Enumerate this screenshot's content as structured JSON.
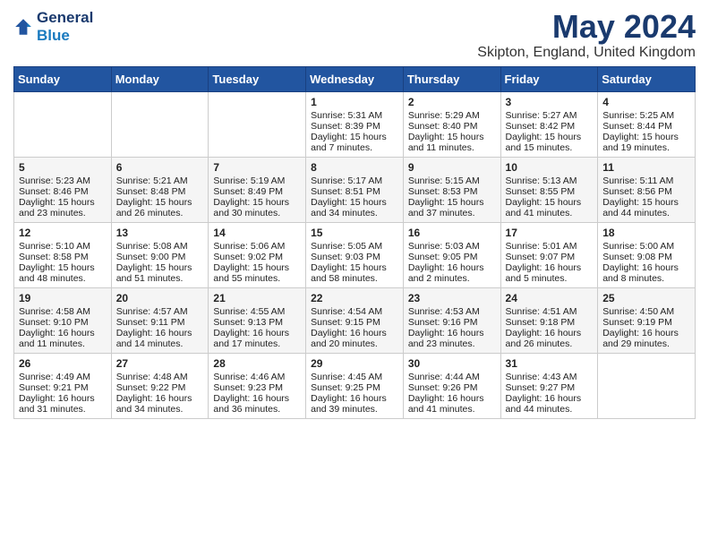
{
  "header": {
    "logo_line1": "General",
    "logo_line2": "Blue",
    "title": "May 2024",
    "subtitle": "Skipton, England, United Kingdom"
  },
  "weekdays": [
    "Sunday",
    "Monday",
    "Tuesday",
    "Wednesday",
    "Thursday",
    "Friday",
    "Saturday"
  ],
  "weeks": [
    [
      {
        "day": "",
        "lines": []
      },
      {
        "day": "",
        "lines": []
      },
      {
        "day": "",
        "lines": []
      },
      {
        "day": "1",
        "lines": [
          "Sunrise: 5:31 AM",
          "Sunset: 8:39 PM",
          "Daylight: 15 hours",
          "and 7 minutes."
        ]
      },
      {
        "day": "2",
        "lines": [
          "Sunrise: 5:29 AM",
          "Sunset: 8:40 PM",
          "Daylight: 15 hours",
          "and 11 minutes."
        ]
      },
      {
        "day": "3",
        "lines": [
          "Sunrise: 5:27 AM",
          "Sunset: 8:42 PM",
          "Daylight: 15 hours",
          "and 15 minutes."
        ]
      },
      {
        "day": "4",
        "lines": [
          "Sunrise: 5:25 AM",
          "Sunset: 8:44 PM",
          "Daylight: 15 hours",
          "and 19 minutes."
        ]
      }
    ],
    [
      {
        "day": "5",
        "lines": [
          "Sunrise: 5:23 AM",
          "Sunset: 8:46 PM",
          "Daylight: 15 hours",
          "and 23 minutes."
        ]
      },
      {
        "day": "6",
        "lines": [
          "Sunrise: 5:21 AM",
          "Sunset: 8:48 PM",
          "Daylight: 15 hours",
          "and 26 minutes."
        ]
      },
      {
        "day": "7",
        "lines": [
          "Sunrise: 5:19 AM",
          "Sunset: 8:49 PM",
          "Daylight: 15 hours",
          "and 30 minutes."
        ]
      },
      {
        "day": "8",
        "lines": [
          "Sunrise: 5:17 AM",
          "Sunset: 8:51 PM",
          "Daylight: 15 hours",
          "and 34 minutes."
        ]
      },
      {
        "day": "9",
        "lines": [
          "Sunrise: 5:15 AM",
          "Sunset: 8:53 PM",
          "Daylight: 15 hours",
          "and 37 minutes."
        ]
      },
      {
        "day": "10",
        "lines": [
          "Sunrise: 5:13 AM",
          "Sunset: 8:55 PM",
          "Daylight: 15 hours",
          "and 41 minutes."
        ]
      },
      {
        "day": "11",
        "lines": [
          "Sunrise: 5:11 AM",
          "Sunset: 8:56 PM",
          "Daylight: 15 hours",
          "and 44 minutes."
        ]
      }
    ],
    [
      {
        "day": "12",
        "lines": [
          "Sunrise: 5:10 AM",
          "Sunset: 8:58 PM",
          "Daylight: 15 hours",
          "and 48 minutes."
        ]
      },
      {
        "day": "13",
        "lines": [
          "Sunrise: 5:08 AM",
          "Sunset: 9:00 PM",
          "Daylight: 15 hours",
          "and 51 minutes."
        ]
      },
      {
        "day": "14",
        "lines": [
          "Sunrise: 5:06 AM",
          "Sunset: 9:02 PM",
          "Daylight: 15 hours",
          "and 55 minutes."
        ]
      },
      {
        "day": "15",
        "lines": [
          "Sunrise: 5:05 AM",
          "Sunset: 9:03 PM",
          "Daylight: 15 hours",
          "and 58 minutes."
        ]
      },
      {
        "day": "16",
        "lines": [
          "Sunrise: 5:03 AM",
          "Sunset: 9:05 PM",
          "Daylight: 16 hours",
          "and 2 minutes."
        ]
      },
      {
        "day": "17",
        "lines": [
          "Sunrise: 5:01 AM",
          "Sunset: 9:07 PM",
          "Daylight: 16 hours",
          "and 5 minutes."
        ]
      },
      {
        "day": "18",
        "lines": [
          "Sunrise: 5:00 AM",
          "Sunset: 9:08 PM",
          "Daylight: 16 hours",
          "and 8 minutes."
        ]
      }
    ],
    [
      {
        "day": "19",
        "lines": [
          "Sunrise: 4:58 AM",
          "Sunset: 9:10 PM",
          "Daylight: 16 hours",
          "and 11 minutes."
        ]
      },
      {
        "day": "20",
        "lines": [
          "Sunrise: 4:57 AM",
          "Sunset: 9:11 PM",
          "Daylight: 16 hours",
          "and 14 minutes."
        ]
      },
      {
        "day": "21",
        "lines": [
          "Sunrise: 4:55 AM",
          "Sunset: 9:13 PM",
          "Daylight: 16 hours",
          "and 17 minutes."
        ]
      },
      {
        "day": "22",
        "lines": [
          "Sunrise: 4:54 AM",
          "Sunset: 9:15 PM",
          "Daylight: 16 hours",
          "and 20 minutes."
        ]
      },
      {
        "day": "23",
        "lines": [
          "Sunrise: 4:53 AM",
          "Sunset: 9:16 PM",
          "Daylight: 16 hours",
          "and 23 minutes."
        ]
      },
      {
        "day": "24",
        "lines": [
          "Sunrise: 4:51 AM",
          "Sunset: 9:18 PM",
          "Daylight: 16 hours",
          "and 26 minutes."
        ]
      },
      {
        "day": "25",
        "lines": [
          "Sunrise: 4:50 AM",
          "Sunset: 9:19 PM",
          "Daylight: 16 hours",
          "and 29 minutes."
        ]
      }
    ],
    [
      {
        "day": "26",
        "lines": [
          "Sunrise: 4:49 AM",
          "Sunset: 9:21 PM",
          "Daylight: 16 hours",
          "and 31 minutes."
        ]
      },
      {
        "day": "27",
        "lines": [
          "Sunrise: 4:48 AM",
          "Sunset: 9:22 PM",
          "Daylight: 16 hours",
          "and 34 minutes."
        ]
      },
      {
        "day": "28",
        "lines": [
          "Sunrise: 4:46 AM",
          "Sunset: 9:23 PM",
          "Daylight: 16 hours",
          "and 36 minutes."
        ]
      },
      {
        "day": "29",
        "lines": [
          "Sunrise: 4:45 AM",
          "Sunset: 9:25 PM",
          "Daylight: 16 hours",
          "and 39 minutes."
        ]
      },
      {
        "day": "30",
        "lines": [
          "Sunrise: 4:44 AM",
          "Sunset: 9:26 PM",
          "Daylight: 16 hours",
          "and 41 minutes."
        ]
      },
      {
        "day": "31",
        "lines": [
          "Sunrise: 4:43 AM",
          "Sunset: 9:27 PM",
          "Daylight: 16 hours",
          "and 44 minutes."
        ]
      },
      {
        "day": "",
        "lines": []
      }
    ]
  ]
}
